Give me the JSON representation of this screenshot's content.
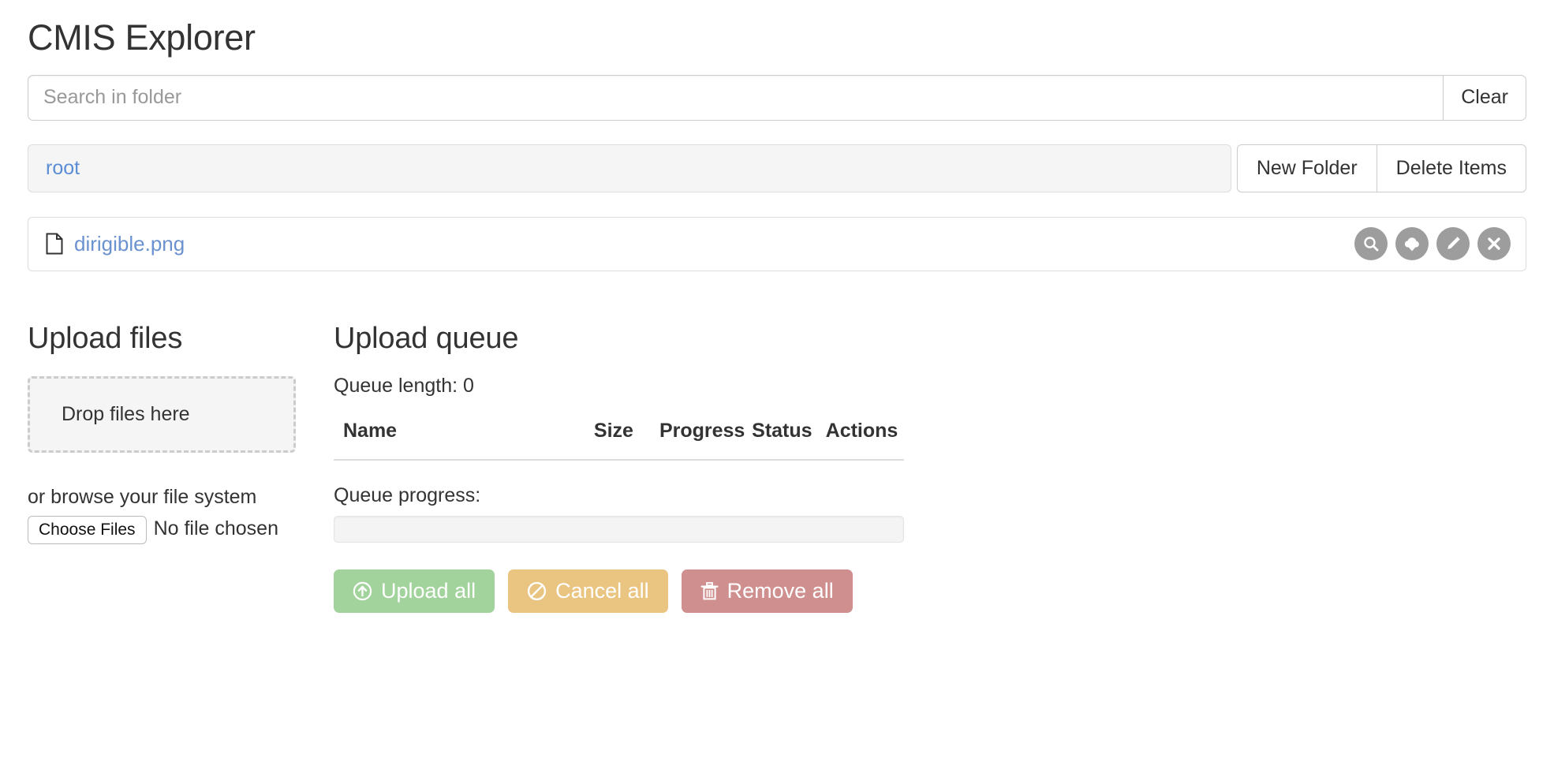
{
  "app": {
    "title": "CMIS Explorer"
  },
  "search": {
    "placeholder": "Search in folder",
    "value": "",
    "clear_label": "Clear"
  },
  "breadcrumb": {
    "items": [
      {
        "label": "root"
      }
    ],
    "new_folder_label": "New Folder",
    "delete_items_label": "Delete Items"
  },
  "file_list": {
    "rows": [
      {
        "name": "dirigible.png",
        "icon": "file-icon",
        "actions": [
          {
            "icon": "search-icon",
            "name": "view"
          },
          {
            "icon": "cloud-download-icon",
            "name": "download"
          },
          {
            "icon": "pencil-icon",
            "name": "edit"
          },
          {
            "icon": "close-icon",
            "name": "delete"
          }
        ]
      }
    ]
  },
  "upload": {
    "title": "Upload files",
    "dropzone_text": "Drop files here",
    "browse_text": "or browse your file system",
    "choose_files_label": "Choose Files",
    "no_file_text": "No file chosen"
  },
  "queue": {
    "title": "Upload queue",
    "length_label": "Queue length: 0",
    "columns": {
      "name": "Name",
      "size": "Size",
      "progress": "Progress",
      "status": "Status",
      "actions": "Actions"
    },
    "rows": [],
    "progress_label": "Queue progress:",
    "progress_value": 0,
    "buttons": {
      "upload_all": "Upload all",
      "cancel_all": "Cancel all",
      "remove_all": "Remove all"
    }
  },
  "colors": {
    "link": "#5b8dd6",
    "file_link": "#6a91d0",
    "upload_all": "#a3d39c",
    "cancel_all": "#eac481",
    "remove_all": "#d08f8f",
    "action_circle": "#9d9d9d",
    "panel_border": "#dddddd",
    "crumb_bg": "#f5f5f5"
  }
}
